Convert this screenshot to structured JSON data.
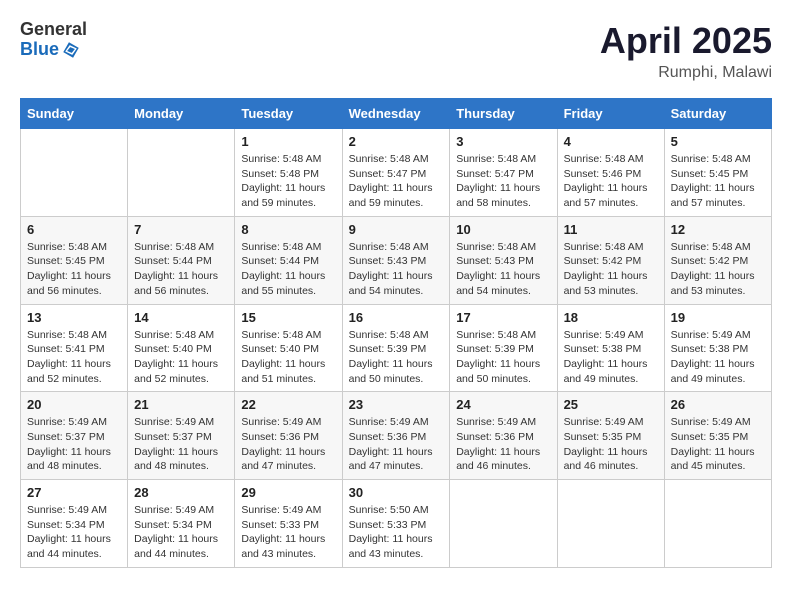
{
  "header": {
    "logo_general": "General",
    "logo_blue": "Blue",
    "title": "April 2025",
    "location": "Rumphi, Malawi"
  },
  "columns": [
    "Sunday",
    "Monday",
    "Tuesday",
    "Wednesday",
    "Thursday",
    "Friday",
    "Saturday"
  ],
  "weeks": [
    [
      {
        "day": "",
        "info": ""
      },
      {
        "day": "",
        "info": ""
      },
      {
        "day": "1",
        "info": "Sunrise: 5:48 AM\nSunset: 5:48 PM\nDaylight: 11 hours and 59 minutes."
      },
      {
        "day": "2",
        "info": "Sunrise: 5:48 AM\nSunset: 5:47 PM\nDaylight: 11 hours and 59 minutes."
      },
      {
        "day": "3",
        "info": "Sunrise: 5:48 AM\nSunset: 5:47 PM\nDaylight: 11 hours and 58 minutes."
      },
      {
        "day": "4",
        "info": "Sunrise: 5:48 AM\nSunset: 5:46 PM\nDaylight: 11 hours and 57 minutes."
      },
      {
        "day": "5",
        "info": "Sunrise: 5:48 AM\nSunset: 5:45 PM\nDaylight: 11 hours and 57 minutes."
      }
    ],
    [
      {
        "day": "6",
        "info": "Sunrise: 5:48 AM\nSunset: 5:45 PM\nDaylight: 11 hours and 56 minutes."
      },
      {
        "day": "7",
        "info": "Sunrise: 5:48 AM\nSunset: 5:44 PM\nDaylight: 11 hours and 56 minutes."
      },
      {
        "day": "8",
        "info": "Sunrise: 5:48 AM\nSunset: 5:44 PM\nDaylight: 11 hours and 55 minutes."
      },
      {
        "day": "9",
        "info": "Sunrise: 5:48 AM\nSunset: 5:43 PM\nDaylight: 11 hours and 54 minutes."
      },
      {
        "day": "10",
        "info": "Sunrise: 5:48 AM\nSunset: 5:43 PM\nDaylight: 11 hours and 54 minutes."
      },
      {
        "day": "11",
        "info": "Sunrise: 5:48 AM\nSunset: 5:42 PM\nDaylight: 11 hours and 53 minutes."
      },
      {
        "day": "12",
        "info": "Sunrise: 5:48 AM\nSunset: 5:42 PM\nDaylight: 11 hours and 53 minutes."
      }
    ],
    [
      {
        "day": "13",
        "info": "Sunrise: 5:48 AM\nSunset: 5:41 PM\nDaylight: 11 hours and 52 minutes."
      },
      {
        "day": "14",
        "info": "Sunrise: 5:48 AM\nSunset: 5:40 PM\nDaylight: 11 hours and 52 minutes."
      },
      {
        "day": "15",
        "info": "Sunrise: 5:48 AM\nSunset: 5:40 PM\nDaylight: 11 hours and 51 minutes."
      },
      {
        "day": "16",
        "info": "Sunrise: 5:48 AM\nSunset: 5:39 PM\nDaylight: 11 hours and 50 minutes."
      },
      {
        "day": "17",
        "info": "Sunrise: 5:48 AM\nSunset: 5:39 PM\nDaylight: 11 hours and 50 minutes."
      },
      {
        "day": "18",
        "info": "Sunrise: 5:49 AM\nSunset: 5:38 PM\nDaylight: 11 hours and 49 minutes."
      },
      {
        "day": "19",
        "info": "Sunrise: 5:49 AM\nSunset: 5:38 PM\nDaylight: 11 hours and 49 minutes."
      }
    ],
    [
      {
        "day": "20",
        "info": "Sunrise: 5:49 AM\nSunset: 5:37 PM\nDaylight: 11 hours and 48 minutes."
      },
      {
        "day": "21",
        "info": "Sunrise: 5:49 AM\nSunset: 5:37 PM\nDaylight: 11 hours and 48 minutes."
      },
      {
        "day": "22",
        "info": "Sunrise: 5:49 AM\nSunset: 5:36 PM\nDaylight: 11 hours and 47 minutes."
      },
      {
        "day": "23",
        "info": "Sunrise: 5:49 AM\nSunset: 5:36 PM\nDaylight: 11 hours and 47 minutes."
      },
      {
        "day": "24",
        "info": "Sunrise: 5:49 AM\nSunset: 5:36 PM\nDaylight: 11 hours and 46 minutes."
      },
      {
        "day": "25",
        "info": "Sunrise: 5:49 AM\nSunset: 5:35 PM\nDaylight: 11 hours and 46 minutes."
      },
      {
        "day": "26",
        "info": "Sunrise: 5:49 AM\nSunset: 5:35 PM\nDaylight: 11 hours and 45 minutes."
      }
    ],
    [
      {
        "day": "27",
        "info": "Sunrise: 5:49 AM\nSunset: 5:34 PM\nDaylight: 11 hours and 44 minutes."
      },
      {
        "day": "28",
        "info": "Sunrise: 5:49 AM\nSunset: 5:34 PM\nDaylight: 11 hours and 44 minutes."
      },
      {
        "day": "29",
        "info": "Sunrise: 5:49 AM\nSunset: 5:33 PM\nDaylight: 11 hours and 43 minutes."
      },
      {
        "day": "30",
        "info": "Sunrise: 5:50 AM\nSunset: 5:33 PM\nDaylight: 11 hours and 43 minutes."
      },
      {
        "day": "",
        "info": ""
      },
      {
        "day": "",
        "info": ""
      },
      {
        "day": "",
        "info": ""
      }
    ]
  ]
}
